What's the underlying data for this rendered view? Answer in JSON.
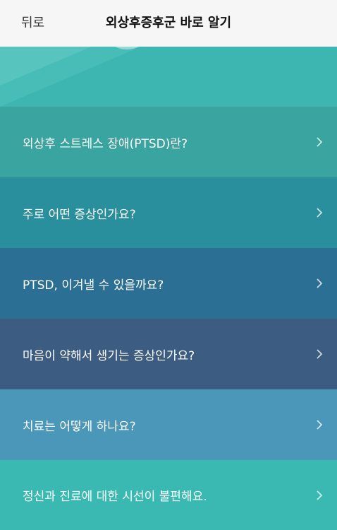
{
  "nav": {
    "back_label": "뒤로",
    "title": "외상후증후군 바로 알기"
  },
  "menu": {
    "items": [
      {
        "label": "외상후 스트레스 장애(PTSD)란?",
        "color": "#3aa5a0"
      },
      {
        "label": "주로 어떤 증상인가요?",
        "color": "#2a8f9c"
      },
      {
        "label": "PTSD, 이겨낼 수 있을까요?",
        "color": "#2c6f94"
      },
      {
        "label": "마음이 약해서 생기는 증상인가요?",
        "color": "#3d5c82"
      },
      {
        "label": "치료는 어떻게 하나요?",
        "color": "#4b97b9"
      },
      {
        "label": "정신과 진료에 대한 시선이 불편해요.",
        "color": "#3ab9b3"
      }
    ]
  },
  "colors": {
    "banner": "#3db6b1",
    "nav_background": "#f6f6f6"
  }
}
